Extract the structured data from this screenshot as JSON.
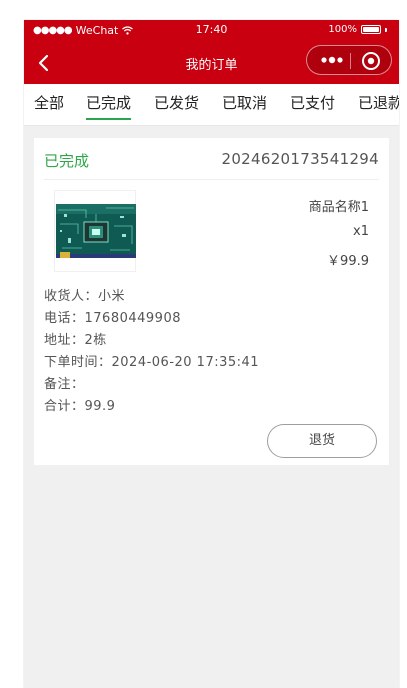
{
  "theme": {
    "primary": "#c8000f",
    "active_tab": "#2aa44f",
    "status_green": "#2fa648"
  },
  "status_bar": {
    "carrier": "WeChat",
    "time": "17:40",
    "battery": "100%"
  },
  "nav": {
    "title": "我的订单",
    "back_icon": "chevron-left-icon",
    "more_icon": "more-dots-icon",
    "close_icon": "target-circle-icon"
  },
  "tabs": [
    {
      "label": "全部"
    },
    {
      "label": "已完成",
      "active": true
    },
    {
      "label": "已发货"
    },
    {
      "label": "已取消"
    },
    {
      "label": "已支付"
    },
    {
      "label": "已退款"
    }
  ],
  "order": {
    "status": "已完成",
    "order_no": "2024620173541294",
    "product": {
      "name": "商品名称1",
      "qty": "x1",
      "price": "￥99.9"
    },
    "consignee": "收货人：小米",
    "phone": "电话：17680449908",
    "address": "地址：2栋",
    "order_time": "下单时间：2024-06-20 17:35:41",
    "remark": "备注：",
    "total": "合计：99.9",
    "action_label": "退货"
  }
}
